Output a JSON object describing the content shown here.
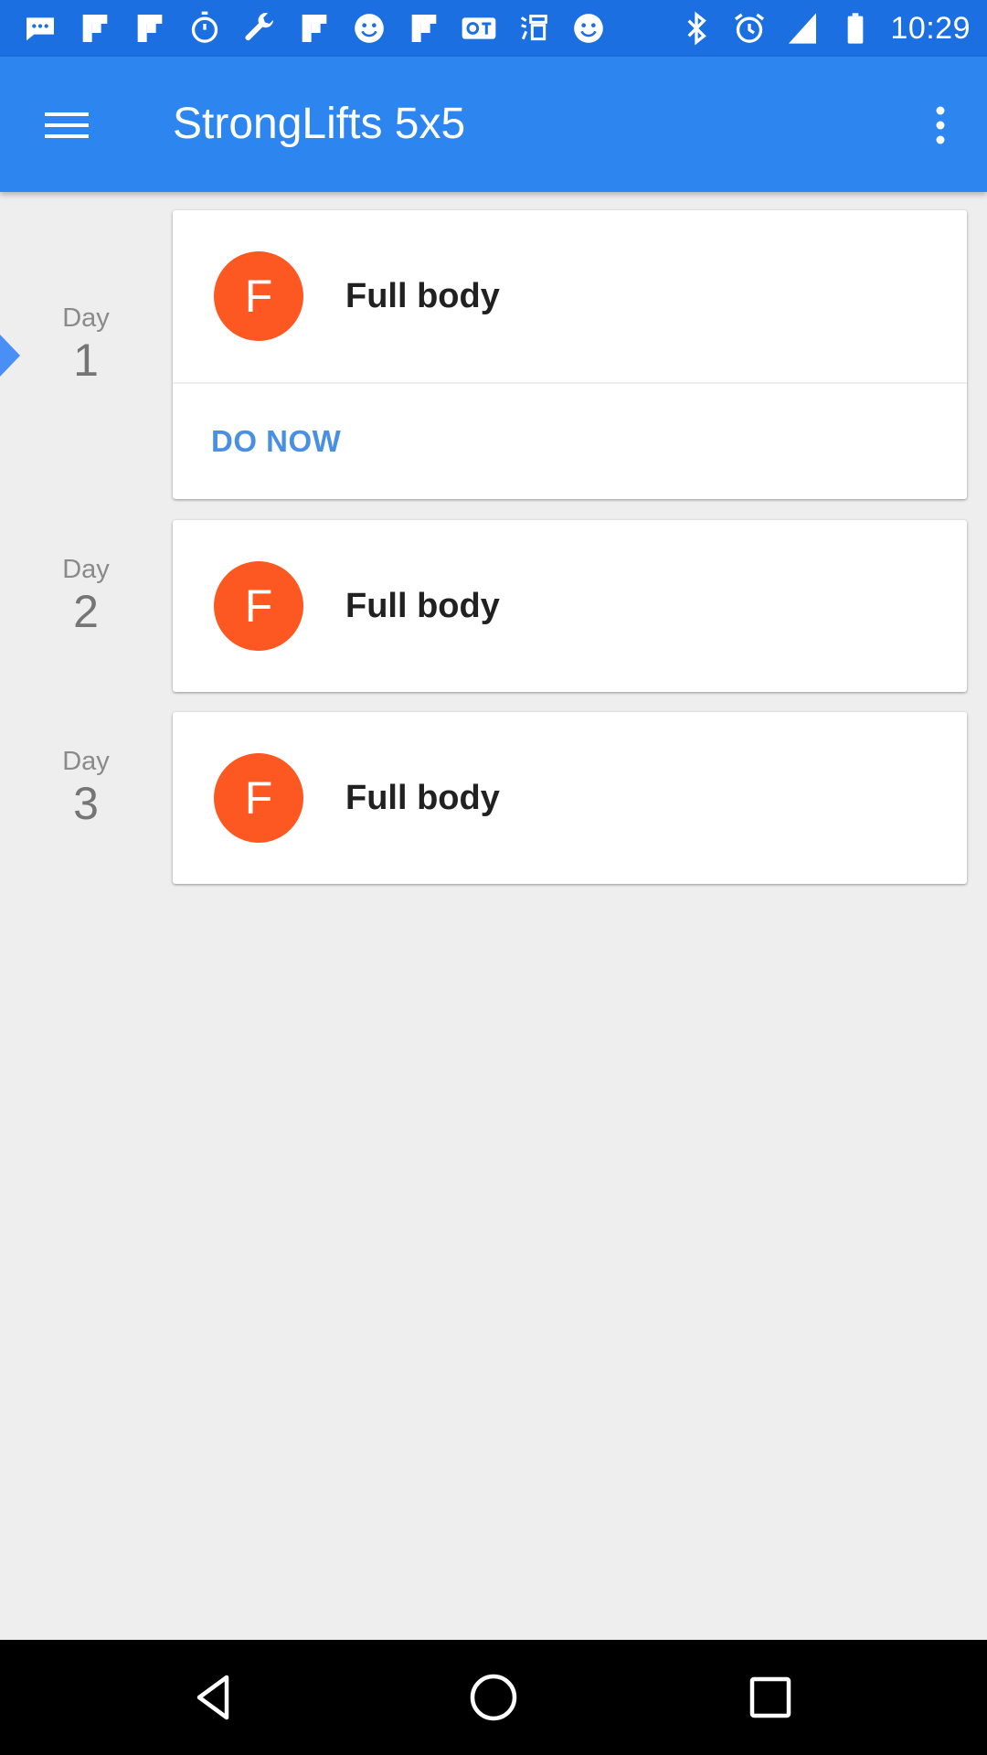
{
  "status_bar": {
    "time": "10:29",
    "left_icons": [
      "chat-icon",
      "flipboard-icon",
      "flipboard-icon",
      "stopwatch-icon",
      "wrench-icon",
      "flipboard-icon",
      "smiley-icon",
      "flipboard-icon",
      "qt-icon",
      "app-icon",
      "smiley-icon"
    ],
    "right_icons": [
      "bluetooth-icon",
      "alarm-icon",
      "signal-icon",
      "battery-icon"
    ],
    "background": "#1b6fe0"
  },
  "app_bar": {
    "title": "StrongLifts 5x5",
    "background": "#2d86f0"
  },
  "days": [
    {
      "day_label": "Day",
      "day_number": "1",
      "avatar_letter": "F",
      "workout": "Full body",
      "action": "DO NOW",
      "current": true
    },
    {
      "day_label": "Day",
      "day_number": "2",
      "avatar_letter": "F",
      "workout": "Full body"
    },
    {
      "day_label": "Day",
      "day_number": "3",
      "avatar_letter": "F",
      "workout": "Full body"
    }
  ],
  "colors": {
    "accent": "#4a90e2",
    "avatar": "#fd5722",
    "background": "#eeeeee"
  },
  "nav_bar": {
    "buttons": [
      "back-icon",
      "home-icon",
      "recents-icon"
    ]
  }
}
